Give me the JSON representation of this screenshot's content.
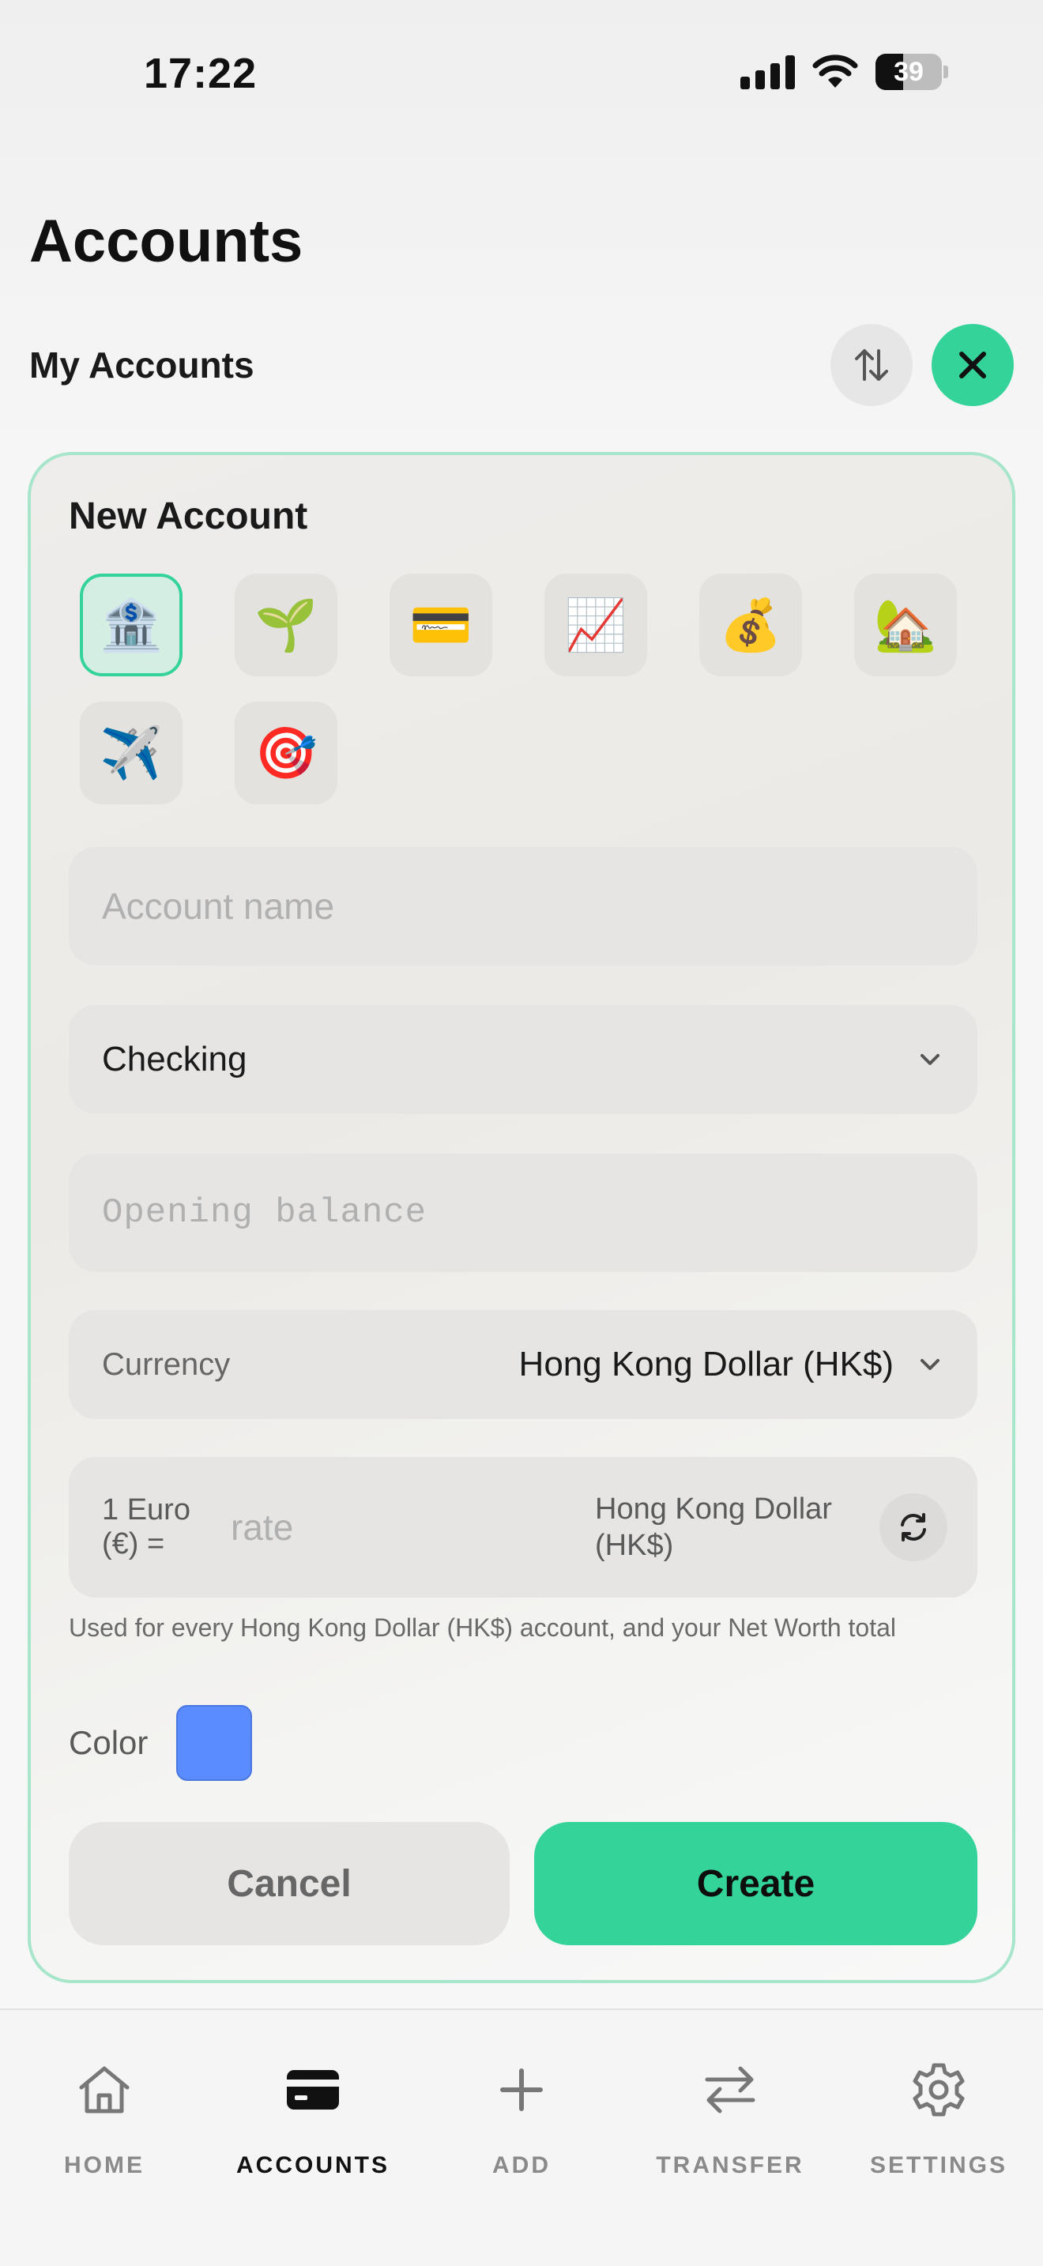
{
  "status_bar": {
    "time": "17:22",
    "battery": "39"
  },
  "header": {
    "title": "Accounts",
    "section_title": "My Accounts",
    "sort_icon": "sort-arrows-icon",
    "close_icon": "close-icon"
  },
  "new_account": {
    "title": "New Account",
    "icons": [
      {
        "name": "bank-icon",
        "glyph": "🏦",
        "selected": true
      },
      {
        "name": "seedling-icon",
        "glyph": "🌱",
        "selected": false
      },
      {
        "name": "credit-card-icon",
        "glyph": "💳",
        "selected": false
      },
      {
        "name": "chart-up-icon",
        "glyph": "📈",
        "selected": false
      },
      {
        "name": "money-bag-icon",
        "glyph": "💰",
        "selected": false
      },
      {
        "name": "house-icon",
        "glyph": "🏡",
        "selected": false
      },
      {
        "name": "airplane-icon",
        "glyph": "✈️",
        "selected": false
      },
      {
        "name": "target-icon",
        "glyph": "🎯",
        "selected": false
      }
    ],
    "account_name_placeholder": "Account name",
    "account_name_value": "",
    "type_value": "Checking",
    "opening_balance_placeholder": "Opening balance",
    "opening_balance_value": "",
    "currency_label": "Currency",
    "currency_value": "Hong Kong Dollar (HK$)",
    "rate_prefix": "1 Euro (€) =",
    "rate_placeholder": "rate",
    "rate_value": "",
    "rate_target": "Hong Kong Dollar (HK$)",
    "hint": "Used for every Hong Kong Dollar (HK$) account, and your Net Worth total",
    "color_label": "Color",
    "color_value": "#5b8cff",
    "cancel_label": "Cancel",
    "create_label": "Create"
  },
  "colors": {
    "accent": "#34d399",
    "selected_border": "#34d399",
    "card_border": "#a8e6cc"
  },
  "tab_bar": {
    "items": [
      {
        "label": "HOME",
        "icon": "home-icon",
        "active": false
      },
      {
        "label": "ACCOUNTS",
        "icon": "card-icon",
        "active": true
      },
      {
        "label": "ADD",
        "icon": "plus-icon",
        "active": false
      },
      {
        "label": "TRANSFER",
        "icon": "transfer-arrows-icon",
        "active": false
      },
      {
        "label": "SETTINGS",
        "icon": "gear-icon",
        "active": false
      }
    ]
  }
}
